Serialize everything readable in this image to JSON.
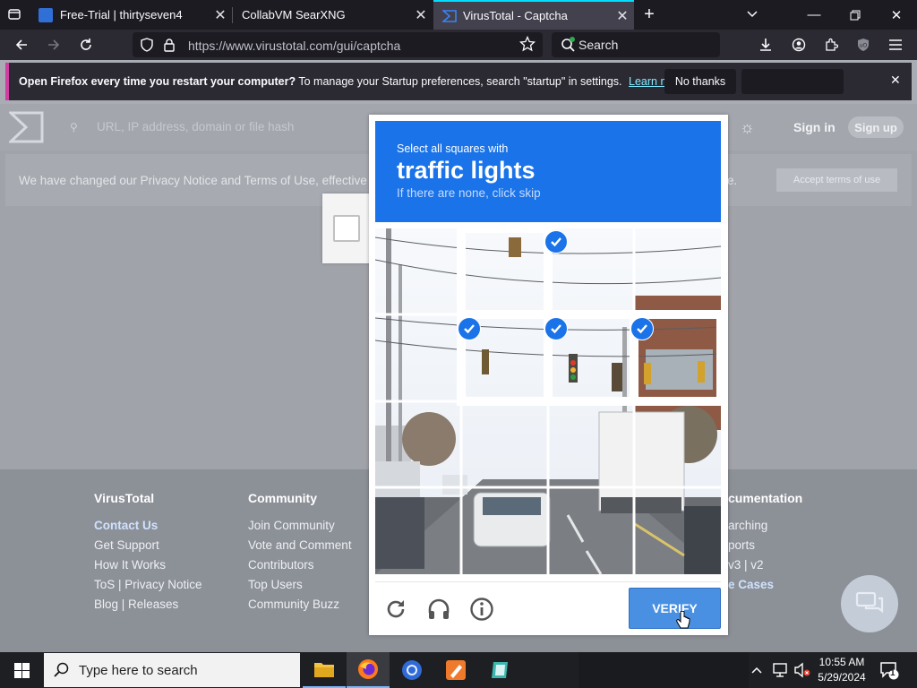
{
  "tabs": [
    {
      "title": "Free-Trial | thirtyseven4",
      "active": false
    },
    {
      "title": "CollabVM SearXNG",
      "active": false
    },
    {
      "title": "VirusTotal - Captcha",
      "active": true
    }
  ],
  "address_bar": {
    "url": "https://www.virustotal.com/gui/captcha",
    "search_placeholder": "Search"
  },
  "notification": {
    "bold": "Open Firefox every time you restart your computer?",
    "text": "To manage your Startup preferences, search \"startup\" in settings.",
    "link": "Learn more",
    "no_thanks": "No thanks"
  },
  "vt_header": {
    "search_placeholder": "URL, IP address, domain or file hash",
    "sign_in": "Sign in",
    "sign_up": "Sign up"
  },
  "privacy_banner": {
    "text": "We have changed our Privacy Notice and Terms of Use, effective Jul",
    "text_end": "e.",
    "accept": "Accept terms of use"
  },
  "footer": {
    "col1": {
      "heading": "VirusTotal",
      "links": [
        "Contact Us",
        "Get Support",
        "How It Works",
        "ToS | Privacy Notice",
        "Blog | Releases"
      ]
    },
    "col2": {
      "heading": "Community",
      "links": [
        "Join Community",
        "Vote and Comment",
        "Contributors",
        "Top Users",
        "Community Buzz"
      ]
    },
    "col4": {
      "heading": "cumentation",
      "links": [
        "arching",
        "ports",
        "v3 | v2",
        "e Cases"
      ]
    }
  },
  "captcha": {
    "instruction": "Select all squares with",
    "target": "traffic lights",
    "hint": "If there are none, click skip",
    "verify": "VERIFY",
    "selected_cells": [
      1,
      4,
      5,
      6
    ]
  },
  "taskbar": {
    "search_placeholder": "Type here to search",
    "time": "10:55 AM",
    "date": "5/29/2024",
    "notification_count": "1"
  },
  "colors": {
    "accent_blue": "#1a73e8",
    "firefox_pink": "#cf3ea0",
    "tab_highlight": "#00ddff"
  }
}
